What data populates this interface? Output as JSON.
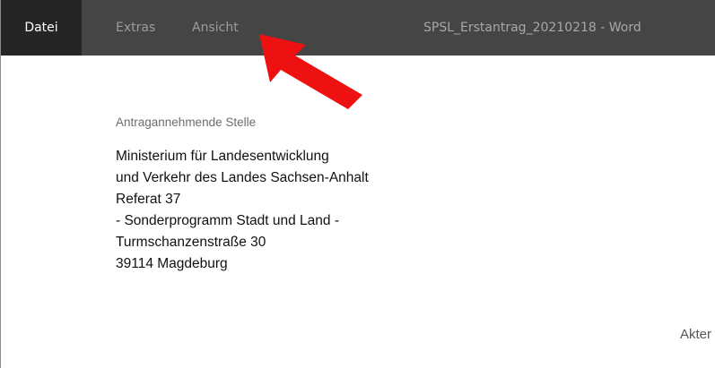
{
  "titlebar": {
    "menu": [
      {
        "label": "Datei",
        "active": true
      },
      {
        "label": "Extras",
        "active": false
      },
      {
        "label": "Ansicht",
        "active": false
      }
    ],
    "window_title": "SPSL_Erstantrag_20210218 - Word"
  },
  "document": {
    "section_label": "Antragannehmende Stelle",
    "address_lines": [
      "Ministerium für Landesentwicklung",
      "und Verkehr des Landes Sachsen-Anhalt",
      "Referat 37",
      "- Sonderprogramm Stadt und Land -",
      "Turmschanzenstraße 30",
      "39114 Magdeburg"
    ],
    "cut_off_text": "Akter"
  },
  "annotation": {
    "arrow_color": "#ee1111",
    "points_to": "Ansicht"
  },
  "colors": {
    "titlebar_bg": "#454545",
    "active_menu_bg": "#252525"
  }
}
